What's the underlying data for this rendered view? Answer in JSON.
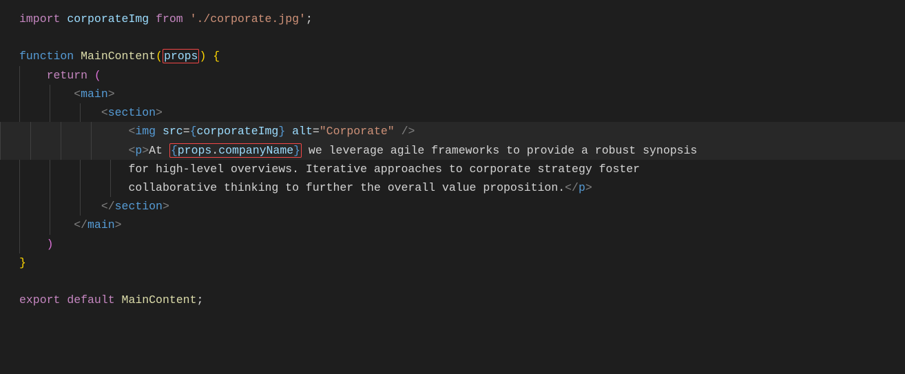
{
  "code": {
    "line1": {
      "import": "import",
      "var": "corporateImg",
      "from": "from",
      "path": "'./corporate.jpg'",
      "semi": ";"
    },
    "line3": {
      "function": "function",
      "name": "MainContent",
      "lparen": "(",
      "param": "props",
      "rparen": ")",
      "lbrace": " {"
    },
    "line4": {
      "return": "return",
      "lparen": " ("
    },
    "line5": {
      "open": "<",
      "tag": "main",
      "close": ">"
    },
    "line6": {
      "open": "<",
      "tag": "section",
      "close": ">"
    },
    "line7": {
      "open": "<",
      "tag": "img",
      "attr1": "src",
      "eq1": "=",
      "lbrace1": "{",
      "val1": "corporateImg",
      "rbrace1": "}",
      "attr2": "alt",
      "eq2": "=",
      "val2": "\"Corporate\"",
      "selfclose": " />"
    },
    "line8": {
      "open": "<",
      "tag": "p",
      "close": ">",
      "text1": "At ",
      "lbrace": "{",
      "expr1": "props",
      "dot": ".",
      "expr2": "companyName",
      "rbrace": "}",
      "text2": " we leverage agile frameworks to provide a robust synopsis"
    },
    "line9": {
      "text": "for high-level overviews. Iterative approaches to corporate strategy foster"
    },
    "line10": {
      "text": "collaborative thinking to further the overall value proposition.",
      "open": "</",
      "tag": "p",
      "close": ">"
    },
    "line11": {
      "open": "</",
      "tag": "section",
      "close": ">"
    },
    "line12": {
      "open": "</",
      "tag": "main",
      "close": ">"
    },
    "line13": {
      "rparen": ")"
    },
    "line14": {
      "rbrace": "}"
    },
    "line16": {
      "export": "export",
      "default": "default",
      "name": "MainContent",
      "semi": ";"
    }
  }
}
